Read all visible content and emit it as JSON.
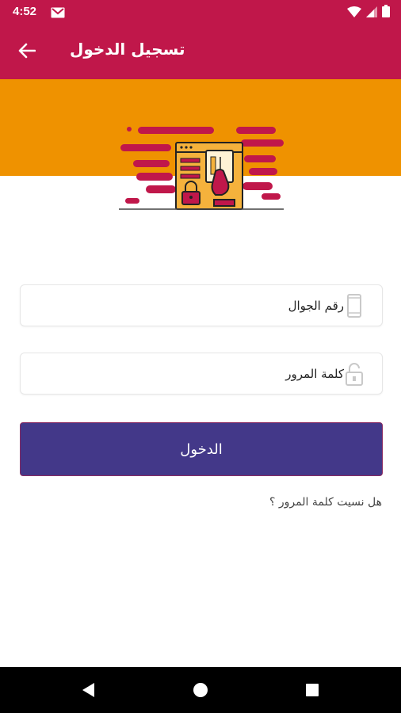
{
  "status_bar": {
    "time": "4:52",
    "icons": [
      "gmail-icon",
      "wifi-icon",
      "signal-icon",
      "battery-icon"
    ]
  },
  "app_bar": {
    "title": "تسجيل الدخول",
    "back_icon": "arrow-back-icon"
  },
  "banner": {
    "illustration": "secure-login-card-illustration"
  },
  "form": {
    "phone_placeholder": "رقم الجوال",
    "phone_icon": "mobile-phone-icon",
    "password_placeholder": "كلمة المرور",
    "password_icon": "padlock-icon",
    "login_label": "الدخول",
    "forgot_label": "هل نسيت كلمة المرور ؟"
  },
  "nav_bar": {
    "buttons": [
      "back-triangle-icon",
      "home-circle-icon",
      "recents-square-icon"
    ]
  },
  "colors": {
    "primary": "#c0174a",
    "banner": "#ef9200",
    "button": "#433889",
    "nav": "#000000"
  }
}
